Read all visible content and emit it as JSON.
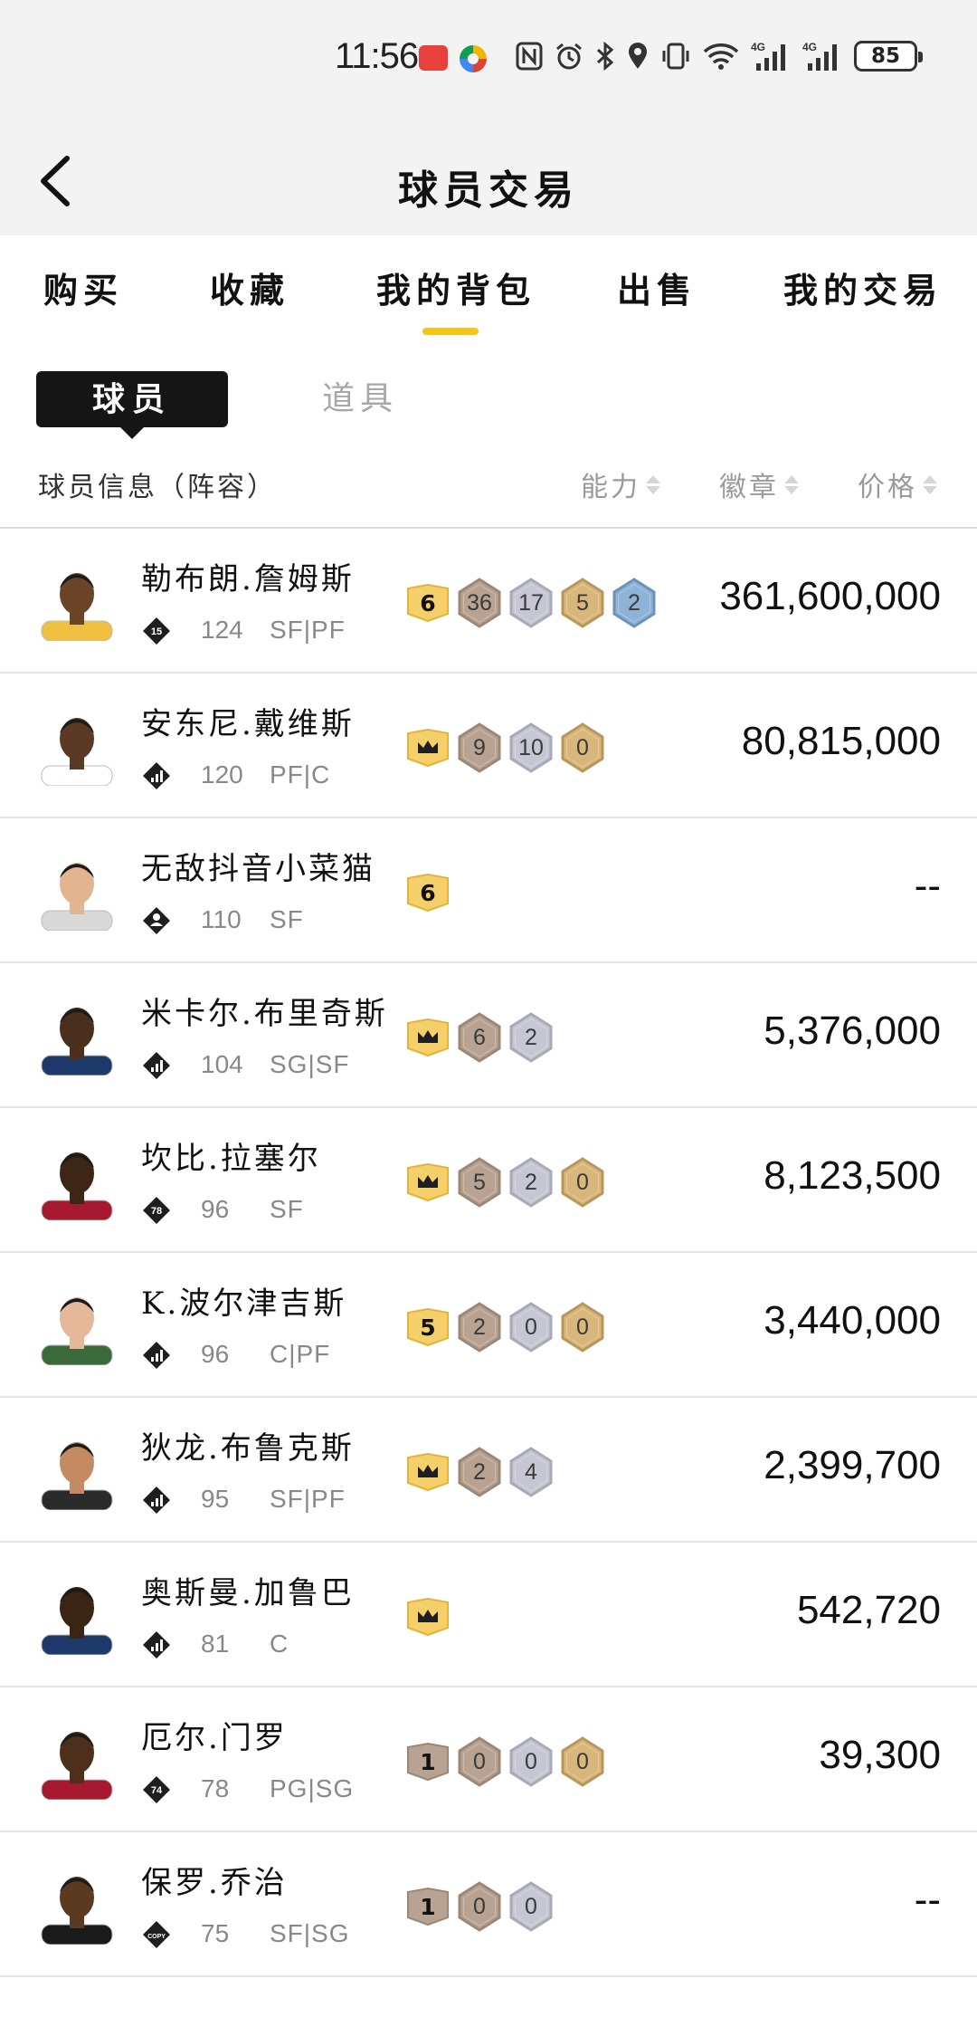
{
  "status_bar": {
    "time": "11:56",
    "battery": "85",
    "icons": [
      "huawei-app-icon",
      "colorful-app-icon",
      "nfc-icon",
      "alarm-icon",
      "bluetooth-icon",
      "location-icon",
      "vibrate-icon",
      "wifi-icon",
      "signal-4g-icon",
      "signal-4g-icon",
      "battery-icon"
    ]
  },
  "header": {
    "title": "球员交易",
    "back_icon": "chevron-left-icon"
  },
  "tabs": [
    {
      "label": "购买",
      "active": false
    },
    {
      "label": "收藏",
      "active": false
    },
    {
      "label": "我的背包",
      "active": true
    },
    {
      "label": "出售",
      "active": false
    },
    {
      "label": "我的交易",
      "active": false
    }
  ],
  "subtabs": {
    "active": "球员",
    "inactive": "道具"
  },
  "columns": {
    "info": "球员信息（阵容）",
    "ability": "能力",
    "badge": "徽章",
    "price": "价格"
  },
  "colors": {
    "accent": "#f5c518",
    "gold": "#f5d06a",
    "bronze": "#b8a292",
    "silver": "#c6c7d2",
    "hof": "#d9b77a",
    "legend": "#8eb3d6"
  },
  "players": [
    {
      "name": "勒布朗.詹姆斯",
      "tag": "15",
      "tag_type": "number",
      "ovr": "124",
      "position": "SF|PF",
      "ability": "6",
      "ability_type": "gold",
      "badges": [
        "36",
        "17",
        "5",
        "2"
      ],
      "price": "361,600,000"
    },
    {
      "name": "安东尼.戴维斯",
      "tag": "",
      "tag_type": "bars",
      "ovr": "120",
      "position": "PF|C",
      "ability": "crown",
      "ability_type": "gold",
      "badges": [
        "9",
        "10",
        "0"
      ],
      "price": "80,815,000"
    },
    {
      "name": "无敌抖音小菜猫",
      "tag": "",
      "tag_type": "person",
      "ovr": "110",
      "position": "SF",
      "ability": "6",
      "ability_type": "gold",
      "badges": [],
      "price": "--"
    },
    {
      "name": "米卡尔.布里奇斯",
      "tag": "",
      "tag_type": "bars",
      "ovr": "104",
      "position": "SG|SF",
      "ability": "crown",
      "ability_type": "gold",
      "badges": [
        "6",
        "2"
      ],
      "price": "5,376,000"
    },
    {
      "name": "坎比.拉塞尔",
      "tag": "78",
      "tag_type": "number",
      "ovr": "96",
      "position": "SF",
      "ability": "crown",
      "ability_type": "gold",
      "badges": [
        "5",
        "2",
        "0"
      ],
      "price": "8,123,500"
    },
    {
      "name": "K.波尔津吉斯",
      "tag": "",
      "tag_type": "bars",
      "ovr": "96",
      "position": "C|PF",
      "ability": "5",
      "ability_type": "gold",
      "badges": [
        "2",
        "0",
        "0"
      ],
      "price": "3,440,000"
    },
    {
      "name": "狄龙.布鲁克斯",
      "tag": "",
      "tag_type": "bars",
      "ovr": "95",
      "position": "SF|PF",
      "ability": "crown",
      "ability_type": "gold",
      "badges": [
        "2",
        "4"
      ],
      "price": "2,399,700"
    },
    {
      "name": "奥斯曼.加鲁巴",
      "tag": "",
      "tag_type": "bars",
      "ovr": "81",
      "position": "C",
      "ability": "crown",
      "ability_type": "gold",
      "badges": [],
      "price": "542,720"
    },
    {
      "name": "厄尔.门罗",
      "tag": "74",
      "tag_type": "number",
      "ovr": "78",
      "position": "PG|SG",
      "ability": "1",
      "ability_type": "bronze",
      "badges": [
        "0",
        "0",
        "0"
      ],
      "price": "39,300"
    },
    {
      "name": "保罗.乔治",
      "tag": "COPY",
      "tag_type": "number",
      "ovr": "75",
      "position": "SF|SG",
      "ability": "1",
      "ability_type": "bronze",
      "badges": [
        "0",
        "0"
      ],
      "price": "--"
    }
  ]
}
